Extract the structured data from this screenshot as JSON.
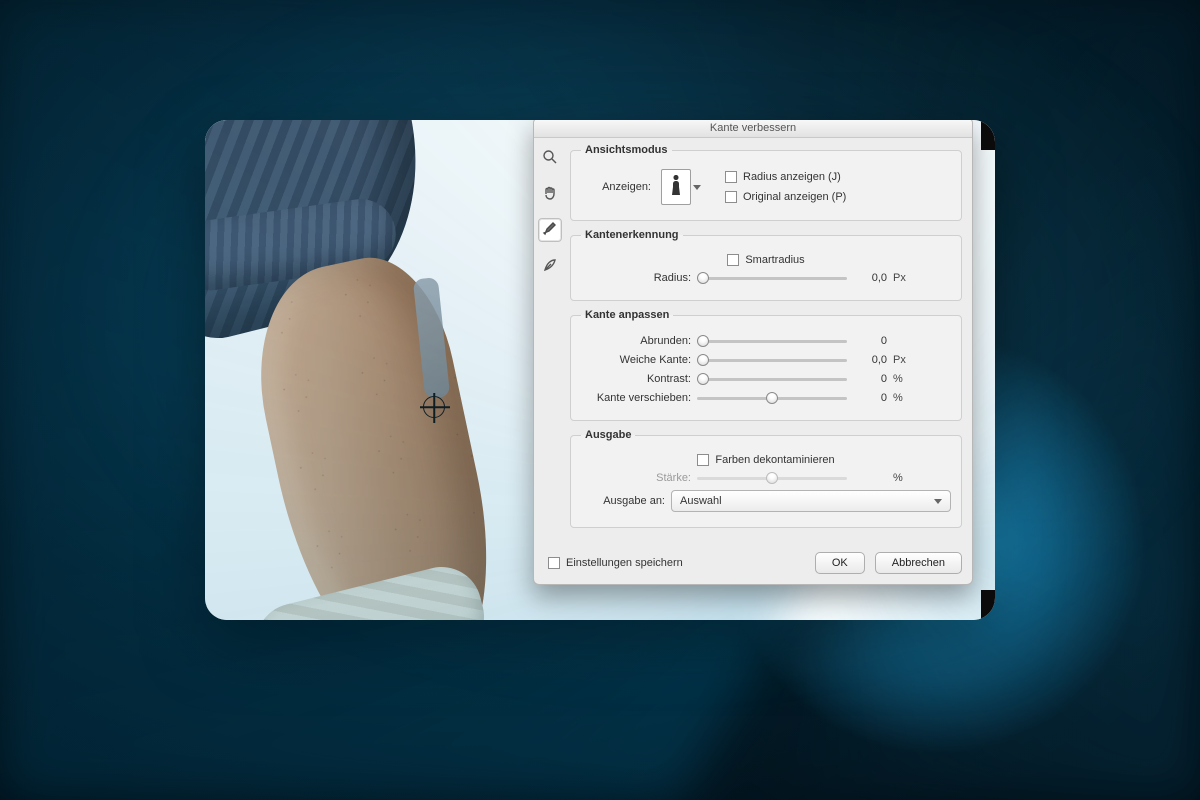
{
  "dialog": {
    "title": "Kante verbessern",
    "tools": {
      "zoom": "zoom",
      "hand": "hand",
      "brush": "brush",
      "refine": "refine"
    },
    "viewMode": {
      "legend": "Ansichtsmodus",
      "showLabel": "Anzeigen:",
      "showRadius": "Radius anzeigen (J)",
      "showOriginal": "Original anzeigen (P)"
    },
    "edgeDetect": {
      "legend": "Kantenerkennung",
      "smartRadius": "Smartradius",
      "radiusLabel": "Radius:",
      "radiusValue": "0,0",
      "radiusUnit": "Px"
    },
    "adjust": {
      "legend": "Kante anpassen",
      "smoothLabel": "Abrunden:",
      "smoothValue": "0",
      "featherLabel": "Weiche Kante:",
      "featherValue": "0,0",
      "featherUnit": "Px",
      "contrastLabel": "Kontrast:",
      "contrastValue": "0",
      "contrastUnit": "%",
      "shiftLabel": "Kante verschieben:",
      "shiftValue": "0",
      "shiftUnit": "%"
    },
    "output": {
      "legend": "Ausgabe",
      "decontaminate": "Farben dekontaminieren",
      "amountLabel": "Stärke:",
      "amountUnit": "%",
      "outputToLabel": "Ausgabe an:",
      "outputToValue": "Auswahl"
    },
    "remember": "Einstellungen speichern",
    "ok": "OK",
    "cancel": "Abbrechen"
  }
}
